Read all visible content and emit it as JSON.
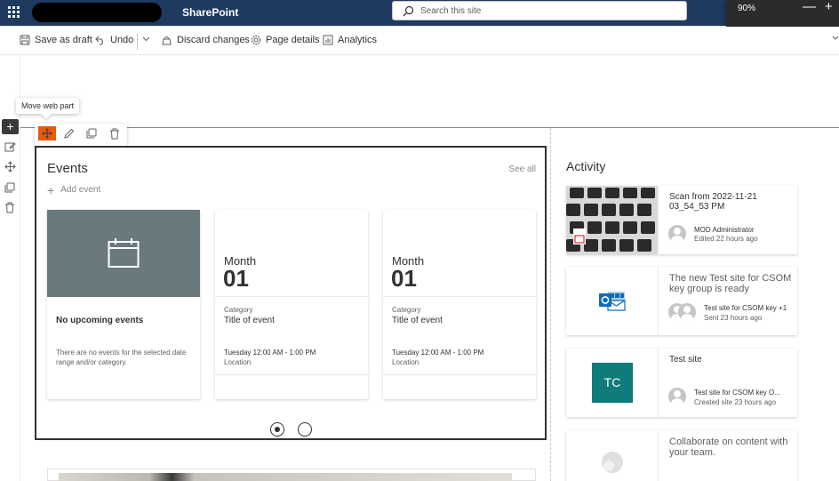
{
  "suite_bar": {
    "app_name": "SharePoint",
    "search_placeholder": "Search this site"
  },
  "zoom": {
    "level": "90%",
    "minus": "—",
    "plus": "+"
  },
  "command_bar": {
    "save_as_draft": "Save as draft",
    "undo": "Undo",
    "discard_changes": "Discard changes",
    "page_details": "Page details",
    "analytics": "Analytics"
  },
  "rail": {
    "add": "+"
  },
  "tooltip": {
    "text": "Move web part"
  },
  "events": {
    "title": "Events",
    "see_all": "See all",
    "add_event": "Add event",
    "no_events_title": "No upcoming events",
    "no_events_desc": "There are no events for the selected date range and/or category.",
    "cards": [
      {
        "month": "Month",
        "day": "01",
        "category": "Category",
        "title": "Title of event",
        "time": "Tuesday 12:00 AM - 1:00 PM",
        "location": "Location"
      },
      {
        "month": "Month",
        "day": "01",
        "category": "Category",
        "title": "Title of event",
        "time": "Tuesday 12:00 AM - 1:00 PM",
        "location": "Location"
      }
    ]
  },
  "activity": {
    "title": "Activity",
    "items": [
      {
        "title": "Scan from 2022-11-21 03_54_53 PM",
        "person": "MOD Administrator",
        "meta": "Edited 22 hours ago"
      },
      {
        "title": "The new Test site for CSOM key group is ready",
        "person": "Test site for CSOM key +1",
        "meta": "Sent 23 hours ago"
      },
      {
        "title": "Test site",
        "initials": "TC",
        "person": "Test site for CSOM key O...",
        "meta": "Created site 23 hours ago"
      },
      {
        "title": "Collaborate on content with your team."
      }
    ]
  },
  "colors": {
    "suite_bar": "#1e3a5f",
    "move_highlight": "#e8590c",
    "no_events_tile": "#69797e",
    "site_tile": "#0f7b7b"
  }
}
